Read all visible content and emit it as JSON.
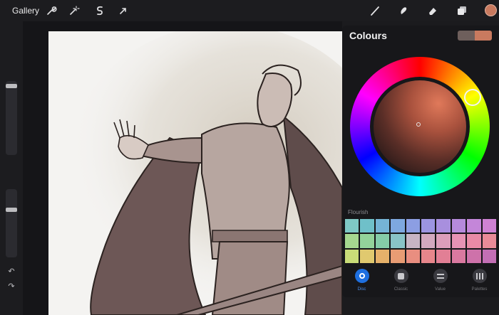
{
  "topbar": {
    "gallery_label": "Gallery",
    "left_tools": [
      {
        "name": "wrench-icon"
      },
      {
        "name": "magic-wand-icon"
      },
      {
        "name": "selection-s-icon"
      },
      {
        "name": "transform-arrow-icon"
      }
    ],
    "right_tools": [
      {
        "name": "brush-icon"
      },
      {
        "name": "smudge-icon"
      },
      {
        "name": "eraser-icon"
      },
      {
        "name": "layers-icon"
      }
    ],
    "active_color": "#c97a5f"
  },
  "colours_panel": {
    "title": "Colours",
    "current_color": "#c97a5f",
    "previous_color": "#6e5f5c",
    "palette_name": "Flourish",
    "palette": [
      "#7fc9c5",
      "#6fc0c9",
      "#75b4d6",
      "#7ea8df",
      "#8c9ee3",
      "#9c95e1",
      "#a88fde",
      "#b68adc",
      "#c486d9",
      "#cf82d3",
      "#a6d88f",
      "#93d39a",
      "#85cca8",
      "#89c3c7",
      "#c7b4c4",
      "#d3a9bf",
      "#dc9eba",
      "#e693b4",
      "#e98aa6",
      "#e98b98",
      "#c9dc78",
      "#e0c96f",
      "#e6b16a",
      "#e89c74",
      "#e98e80",
      "#e7868b",
      "#e27f95",
      "#da79a0",
      "#ce72aa",
      "#c36fb5"
    ],
    "tabs": [
      {
        "label": "Disc",
        "active": true
      },
      {
        "label": "Classic",
        "active": false
      },
      {
        "label": "Value",
        "active": false
      },
      {
        "label": "Palettes",
        "active": false
      }
    ]
  }
}
